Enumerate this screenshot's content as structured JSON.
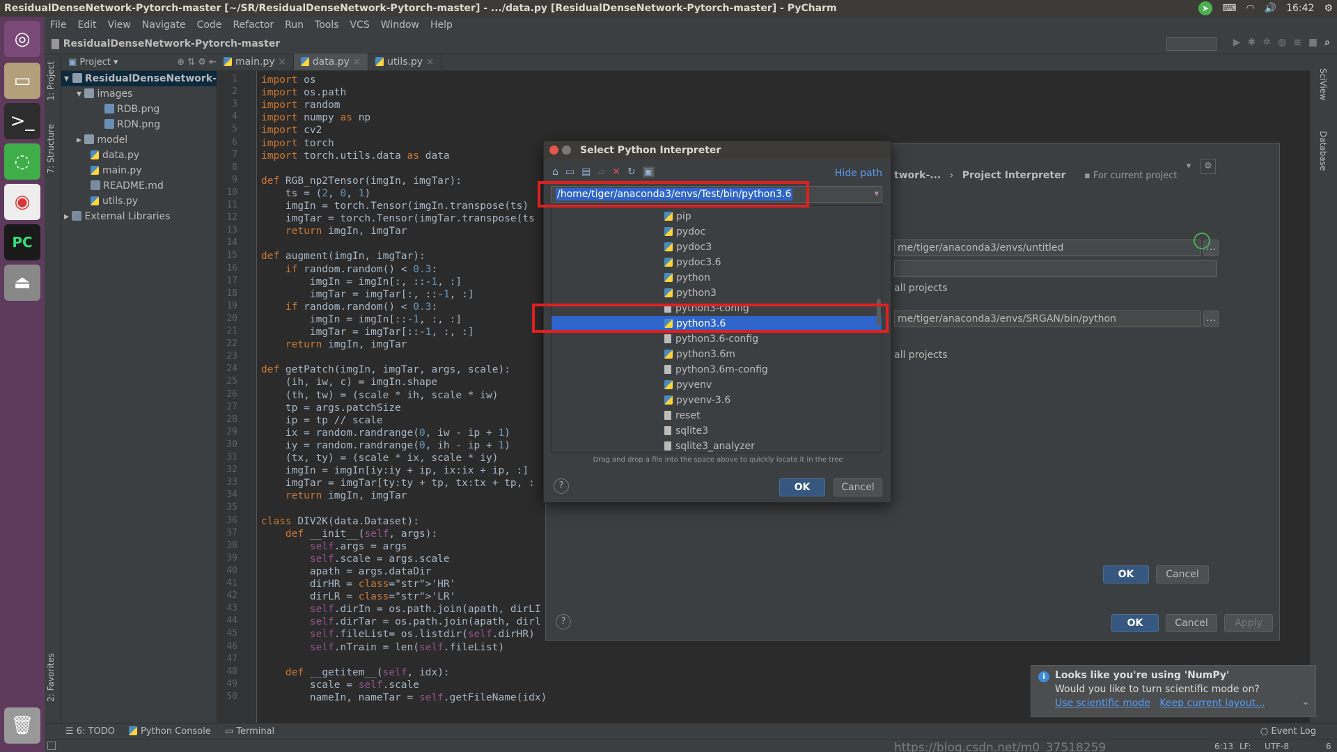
{
  "window_title": "ResidualDenseNetwork-Pytorch-master [~/SR/ResidualDenseNetwork-Pytorch-master] - .../data.py [ResidualDenseNetwork-Pytorch-master] - PyCharm",
  "clock": "16:42",
  "menu": [
    "File",
    "Edit",
    "View",
    "Navigate",
    "Code",
    "Refactor",
    "Run",
    "Tools",
    "VCS",
    "Window",
    "Help"
  ],
  "breadcrumb": "ResidualDenseNetwork-Pytorch-master",
  "project_header": "Project",
  "tree": {
    "root": "ResidualDenseNetwork-F",
    "images": "images",
    "rdb": "RDB.png",
    "rdn": "RDN.png",
    "model": "model",
    "data": "data.py",
    "main": "main.py",
    "readme": "README.md",
    "utils": "utils.py",
    "ext": "External Libraries"
  },
  "side_labels": {
    "project": "1: Project",
    "structure": "7: Structure",
    "favorites": "2: Favorites",
    "sciview": "SciView",
    "database": "Database"
  },
  "tabs": [
    "main.py",
    "data.py",
    "utils.py"
  ],
  "code_lines": [
    "import os",
    "import os.path",
    "import random",
    "import numpy as np",
    "import cv2",
    "import torch",
    "import torch.utils.data as data",
    "",
    "def RGB_np2Tensor(imgIn, imgTar):",
    "    ts = (2, 0, 1)",
    "    imgIn = torch.Tensor(imgIn.transpose(ts)",
    "    imgTar = torch.Tensor(imgTar.transpose(ts",
    "    return imgIn, imgTar",
    "",
    "def augment(imgIn, imgTar):",
    "    if random.random() < 0.3:",
    "        imgIn = imgIn[:, ::-1, :]",
    "        imgTar = imgTar[:, ::-1, :]",
    "    if random.random() < 0.3:",
    "        imgIn = imgIn[::-1, :, :]",
    "        imgTar = imgTar[::-1, :, :]",
    "    return imgIn, imgTar",
    "",
    "def getPatch(imgIn, imgTar, args, scale):",
    "    (ih, iw, c) = imgIn.shape",
    "    (th, tw) = (scale * ih, scale * iw)",
    "    tp = args.patchSize",
    "    ip = tp // scale",
    "    ix = random.randrange(0, iw - ip + 1)",
    "    iy = random.randrange(0, ih - ip + 1)",
    "    (tx, ty) = (scale * ix, scale * iy)",
    "    imgIn = imgIn[iy:iy + ip, ix:ix + ip, :]",
    "    imgTar = imgTar[ty:ty + tp, tx:tx + tp, :",
    "    return imgIn, imgTar",
    "",
    "class DIV2K(data.Dataset):",
    "    def __init__(self, args):",
    "        self.args = args",
    "        self.scale = args.scale",
    "        apath = args.dataDir",
    "        dirHR = 'HR'",
    "        dirLR = 'LR'",
    "        self.dirIn = os.path.join(apath, dirLI",
    "        self.dirTar = os.path.join(apath, dirl",
    "        self.fileList= os.listdir(self.dirHR)",
    "        self.nTrain = len(self.fileList)",
    "",
    "    def __getitem__(self, idx):",
    "        scale = self.scale",
    "        nameIn, nameTar = self.getFileName(idx)"
  ],
  "bottom_tools": [
    "6: TODO",
    "Python Console",
    "Terminal"
  ],
  "status": {
    "pos": "6:13",
    "lf": "LF:",
    "enc": "UTF-8",
    "extra": "6"
  },
  "watermark": "https://blog.csdn.net/m0_37518259",
  "settings": {
    "breadcrumb1": "twork-...",
    "breadcrumb_sep": "›",
    "breadcrumb2": "Project Interpreter",
    "for_current": "For current project",
    "path1": "me/tiger/anaconda3/envs/untitled",
    "all_projects1": "all projects",
    "path2": "me/tiger/anaconda3/envs/SRGAN/bin/python",
    "all_projects2": "all projects",
    "inner_ok": "OK",
    "inner_cancel": "Cancel",
    "ok": "OK",
    "cancel": "Cancel",
    "apply": "Apply"
  },
  "dialog": {
    "title": "Select Python Interpreter",
    "hide_path": "Hide path",
    "path": "/home/tiger/anaconda3/envs/Test/bin/python3.6",
    "files": [
      "pip",
      "pydoc",
      "pydoc3",
      "pydoc3.6",
      "python",
      "python3",
      "python3-config",
      "python3.6",
      "python3.6-config",
      "python3.6m",
      "python3.6m-config",
      "pyvenv",
      "pyvenv-3.6",
      "reset",
      "sqlite3",
      "sqlite3_analyzer"
    ],
    "selected_index": 7,
    "hint": "Drag and drop a file into the space above to quickly locate it in the tree",
    "ok": "OK",
    "cancel": "Cancel",
    "help": "?"
  },
  "notification": {
    "title": "Looks like you're using 'NumPy'",
    "body": "Would you like to turn scientific mode on?",
    "link1": "Use scientific mode",
    "link2": "Keep current layout..."
  },
  "event_log": "Event Log",
  "colors": {
    "accent": "#2f65ca",
    "highlight_red": "#e02020",
    "ok_button": "#365880"
  }
}
